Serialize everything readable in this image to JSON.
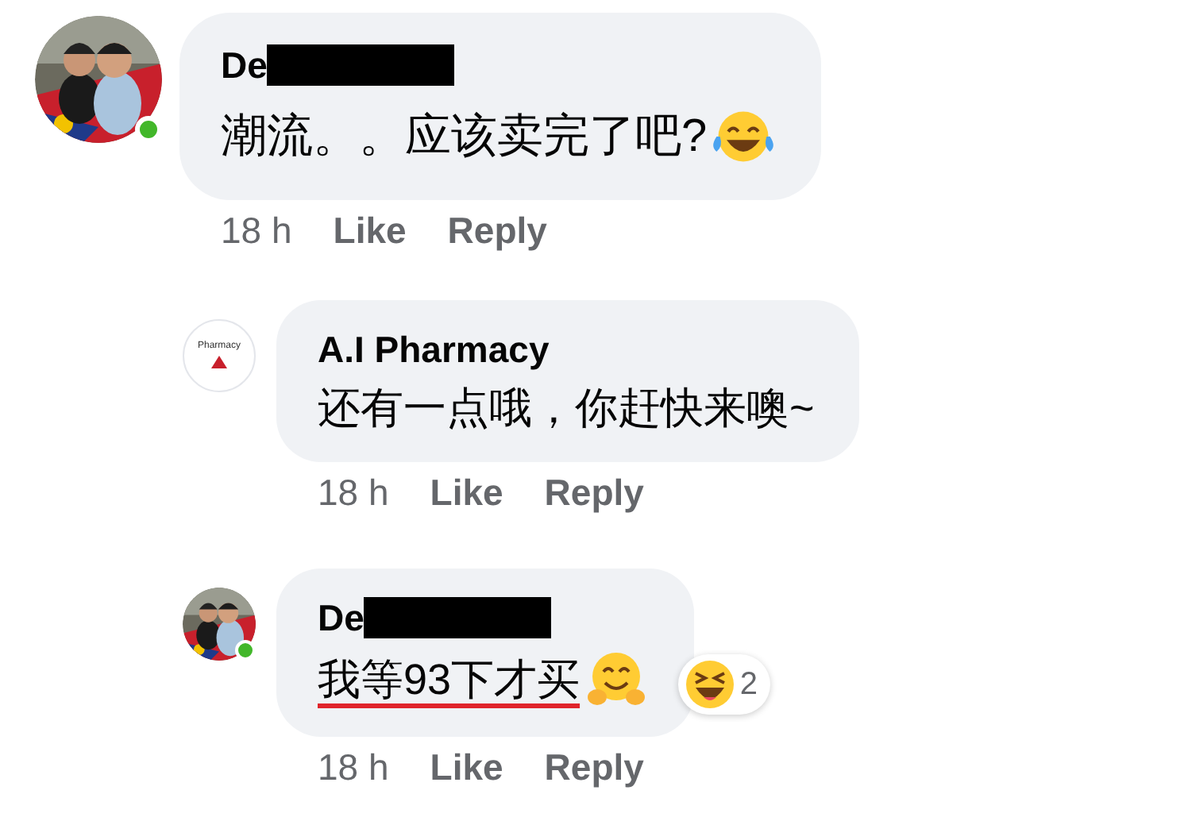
{
  "comments": [
    {
      "kind": "user",
      "reply": false,
      "online": true,
      "name": "De",
      "redacted": true,
      "text": "潮流。。应该卖完了吧?",
      "emoji": {
        "kind": "tears-of-joy"
      },
      "underlined": false,
      "time": "18 h",
      "actions": [
        "Like",
        "Reply"
      ]
    },
    {
      "kind": "page",
      "reply": true,
      "online": false,
      "logo_text": "Pharmacy",
      "name": "A.I Pharmacy",
      "text": "还有一点哦，你赶快来噢~",
      "underlined": false,
      "time": "18 h",
      "actions": [
        "Like",
        "Reply"
      ]
    },
    {
      "kind": "user",
      "reply": true,
      "online": true,
      "name": "De",
      "redacted": true,
      "text": "我等93下才买",
      "emoji": {
        "kind": "hugging"
      },
      "underlined": true,
      "reaction_count": "2",
      "time": "18 h",
      "actions": [
        "Like",
        "Reply"
      ]
    }
  ]
}
